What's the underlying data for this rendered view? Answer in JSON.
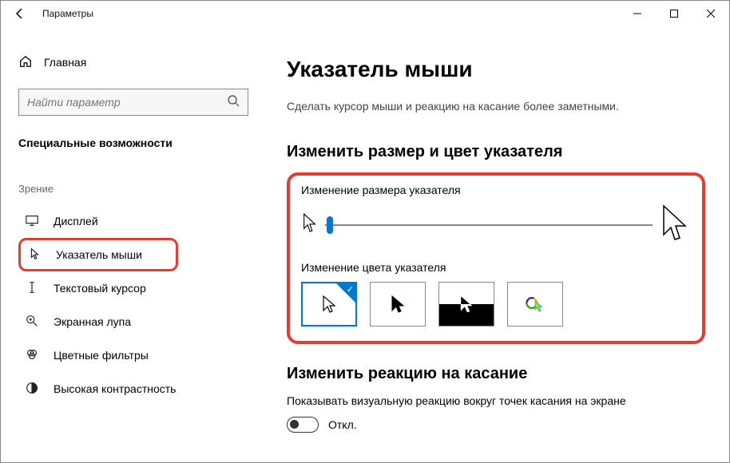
{
  "window": {
    "title": "Параметры"
  },
  "sidebar": {
    "home": "Главная",
    "search_placeholder": "Найти параметр",
    "section_title": "Специальные возможности",
    "group_label": "Зрение",
    "items": [
      {
        "label": "Дисплей"
      },
      {
        "label": "Указатель мыши"
      },
      {
        "label": "Текстовый курсор"
      },
      {
        "label": "Экранная лупа"
      },
      {
        "label": "Цветные фильтры"
      },
      {
        "label": "Высокая контрастность"
      }
    ]
  },
  "main": {
    "title": "Указатель мыши",
    "subtitle": "Сделать курсор мыши и реакцию на касание более заметными.",
    "section1_title": "Изменить размер и цвет указателя",
    "size_label": "Изменение размера указателя",
    "color_label": "Изменение цвета указателя",
    "section2_title": "Изменить реакцию на касание",
    "touch_descr": "Показывать визуальную реакцию вокруг точек касания на экране",
    "toggle_state": "Откл."
  }
}
